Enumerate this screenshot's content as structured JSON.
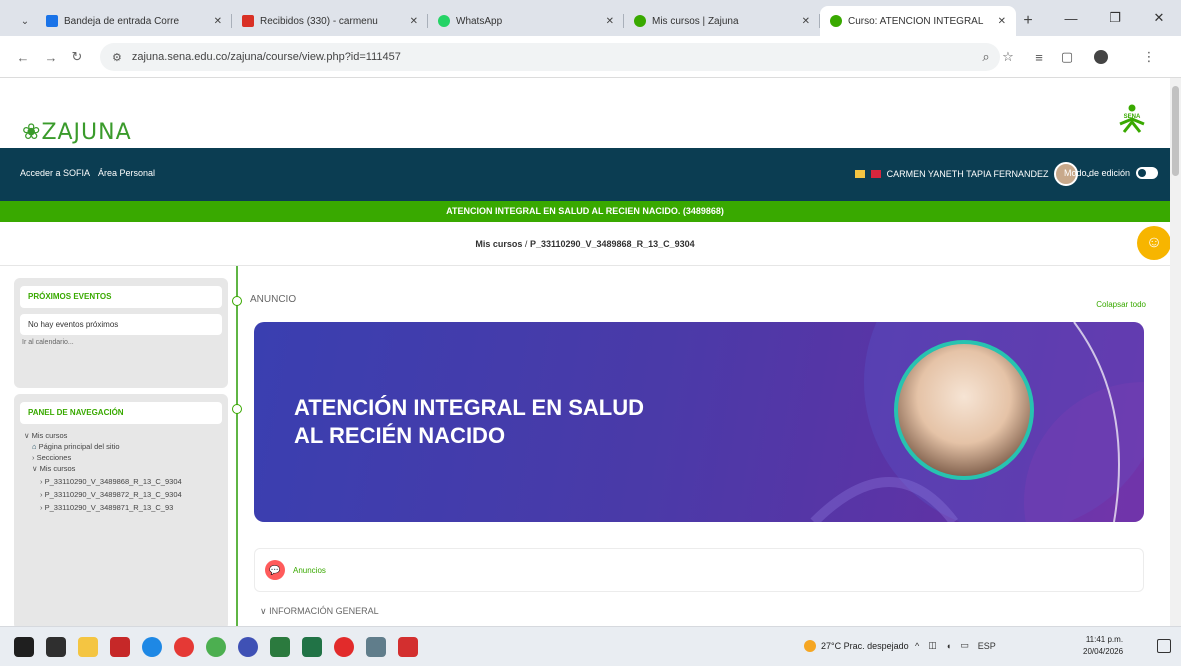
{
  "browser": {
    "tabs": [
      {
        "title": "Bandeja de entrada Corre",
        "color": "#1a73e8"
      },
      {
        "title": "Recibidos (330) - carmenu",
        "color": "#d93025"
      },
      {
        "title": "WhatsApp",
        "color": "#25d366"
      },
      {
        "title": "Mis cursos | Zajuna",
        "color": "#39a900"
      },
      {
        "title": "Curso: ATENCION INTEGRAL",
        "color": "#39a900",
        "active": true
      }
    ],
    "url": "zajuna.sena.edu.co/zajuna/course/view.php?id=111457"
  },
  "site": {
    "logo_text": "ZAJUNA",
    "sena_text": "SENA",
    "nav_sofia": "Acceder a SOFIA",
    "nav_area": "Área Personal",
    "user_name": "CARMEN YANETH TAPIA FERNANDEZ",
    "edit_mode": "Modo de edición",
    "course_banner": "ATENCION INTEGRAL EN SALUD AL RECIEN NACIDO. (3489868)",
    "breadcrumb_root": "Mis cursos",
    "breadcrumb_sep": "/",
    "breadcrumb_current": "P_33110290_V_3489868_R_13_C_9304"
  },
  "sidebar": {
    "events_title": "PRÓXIMOS EVENTOS",
    "events_empty": "No hay eventos próximos",
    "events_link": "Ir al calendario...",
    "nav_title": "PANEL DE NAVEGACIÓN",
    "nav_items": [
      {
        "label": "Mis cursos",
        "level": 0,
        "prefix": "∨"
      },
      {
        "label": "Página principal del sitio",
        "level": 1,
        "prefix": "⌂"
      },
      {
        "label": "Secciones",
        "level": 1,
        "prefix": "›"
      },
      {
        "label": "Mis cursos",
        "level": 1,
        "prefix": "∨"
      },
      {
        "label": "P_33110290_V_3489868_R_13_C_9304",
        "level": 2,
        "prefix": "›"
      },
      {
        "label": "P_33110290_V_3489872_R_13_C_9304",
        "level": 2,
        "prefix": "›"
      },
      {
        "label": "P_33110290_V_3489871_R_13_C_93",
        "level": 2,
        "prefix": "›"
      }
    ]
  },
  "main": {
    "section_title": "ANUNCIO",
    "collapse_all": "Colapsar todo",
    "hero_title_line1": "ATENCIÓN INTEGRAL EN SALUD",
    "hero_title_line2": "AL RECIÉN NACIDO",
    "anuncios_label": "Anuncios",
    "next_section": "INFORMACIÓN GENERAL"
  },
  "taskbar": {
    "weather": "27°C  Prac. despejado",
    "time": "11:41 p.m.",
    "date": "20/04/2026",
    "lang": "ESP"
  }
}
